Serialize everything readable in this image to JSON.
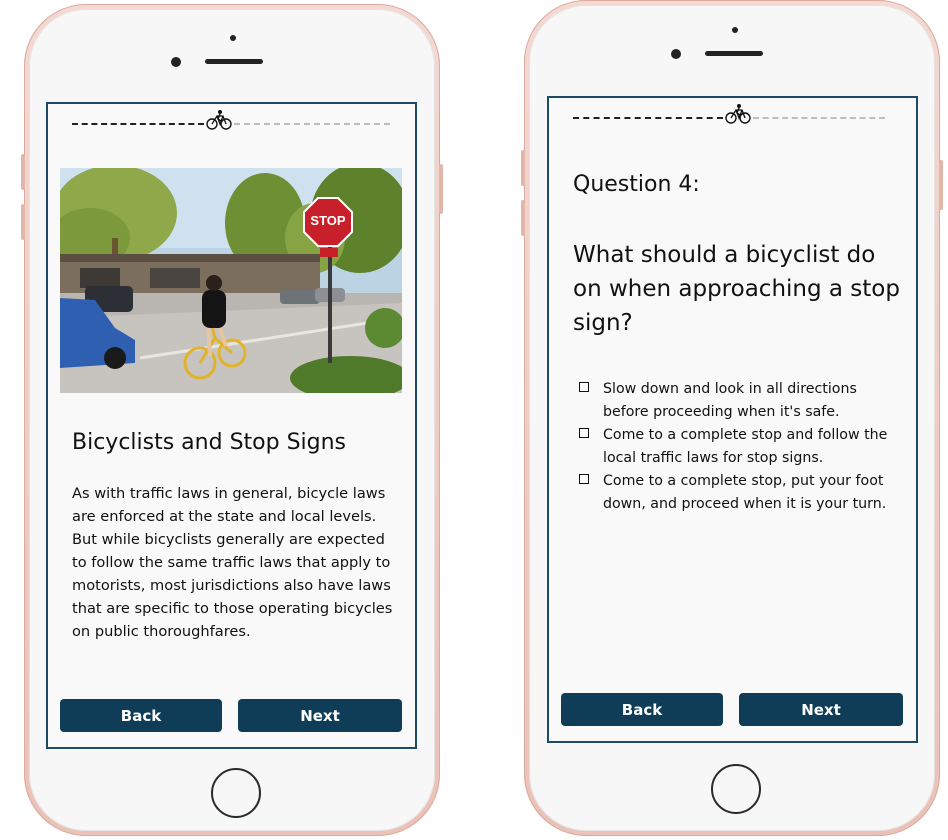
{
  "lesson_screen": {
    "title": "Bicyclists and Stop Signs",
    "body": "As with traffic laws in general, bicycle laws are enforced at the state and local levels. But while bicyclists generally are expected to follow the same traffic laws that apply to motorists, most jurisdictions also have laws that are specific to those operating bicycles on public thoroughfares.",
    "photo_icon": "bicyclist-at-stop-sign-photo",
    "stop_sign_text": "STOP",
    "back_label": "Back",
    "next_label": "Next"
  },
  "quiz_screen": {
    "question_label": "Question 4:",
    "question_text": "What should a bicyclist do on when approaching a stop sign?",
    "options": [
      "Slow down and look in all directions before proceeding when it's safe.",
      "Come to a complete stop and follow the local traffic laws for stop signs.",
      "Come to a complete stop, put your foot down, and proceed when it is your turn."
    ],
    "back_label": "Back",
    "next_label": "Next"
  },
  "progress_icon": "bicycle-icon",
  "colors": {
    "button": "#0f3d57",
    "screen_border": "#1f4a66",
    "phone_body": "#f0d3cb"
  }
}
